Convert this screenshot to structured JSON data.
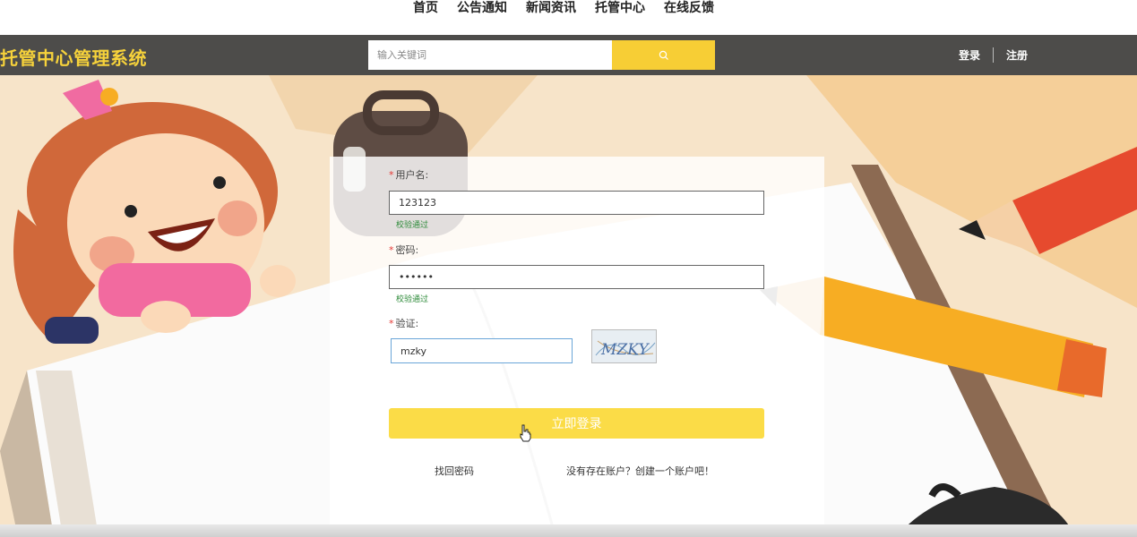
{
  "nav": {
    "items": [
      "首页",
      "公告通知",
      "新闻资讯",
      "托管中心",
      "在线反馈"
    ]
  },
  "header": {
    "brand": "托管中心管理系统",
    "search_placeholder": "输入关键词",
    "search_icon": "search-icon",
    "login": "登录",
    "register": "注册"
  },
  "form": {
    "username_label": "用户名:",
    "username_value": "123123",
    "username_status": "校验通过",
    "password_label": "密码:",
    "password_value": "123456",
    "password_status": "校验通过",
    "captcha_label": "验证:",
    "captcha_value": "mzky",
    "captcha_image_text": "MZKY",
    "required_mark": "*",
    "submit_label": "立即登录",
    "forgot_password": "找回密码",
    "create_account": "没有存在账户？创建一个账户吧！"
  },
  "colors": {
    "accent": "#f7ce35",
    "header_bg": "#4d4c4a",
    "brand": "#f6d23b",
    "success": "#2e8b3a"
  }
}
